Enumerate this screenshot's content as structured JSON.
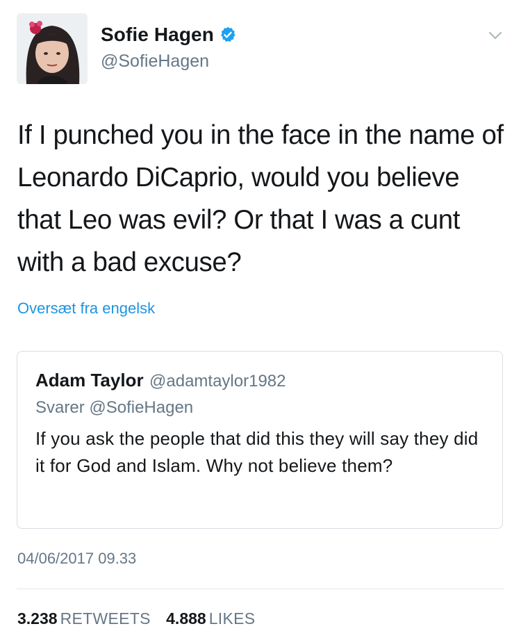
{
  "author": {
    "display_name": "Sofie Hagen",
    "handle": "@SofieHagen",
    "verified_icon": "verified-badge-icon",
    "accent_color": "#1da1f2"
  },
  "tweet": {
    "text": "If I punched you in the face in the name of Leonardo DiCaprio, would you believe that Leo was evil? Or that I was a cunt with a bad excuse?",
    "translate_label": "Oversæt fra engelsk",
    "timestamp": "04/06/2017 09.33"
  },
  "quoted": {
    "display_name": "Adam Taylor",
    "handle": "@adamtaylor1982",
    "reply_line": "Svarer @SofieHagen",
    "text": "If you ask the people that did this they will say they did it for God and Islam. Why not believe them?"
  },
  "stats": {
    "retweets_count": "3.238",
    "retweets_label": "RETWEETS",
    "likes_count": "4.888",
    "likes_label": "LIKES"
  },
  "colors": {
    "link": "#1b95e0",
    "secondary_text": "#657786",
    "border": "#d8dee3"
  }
}
